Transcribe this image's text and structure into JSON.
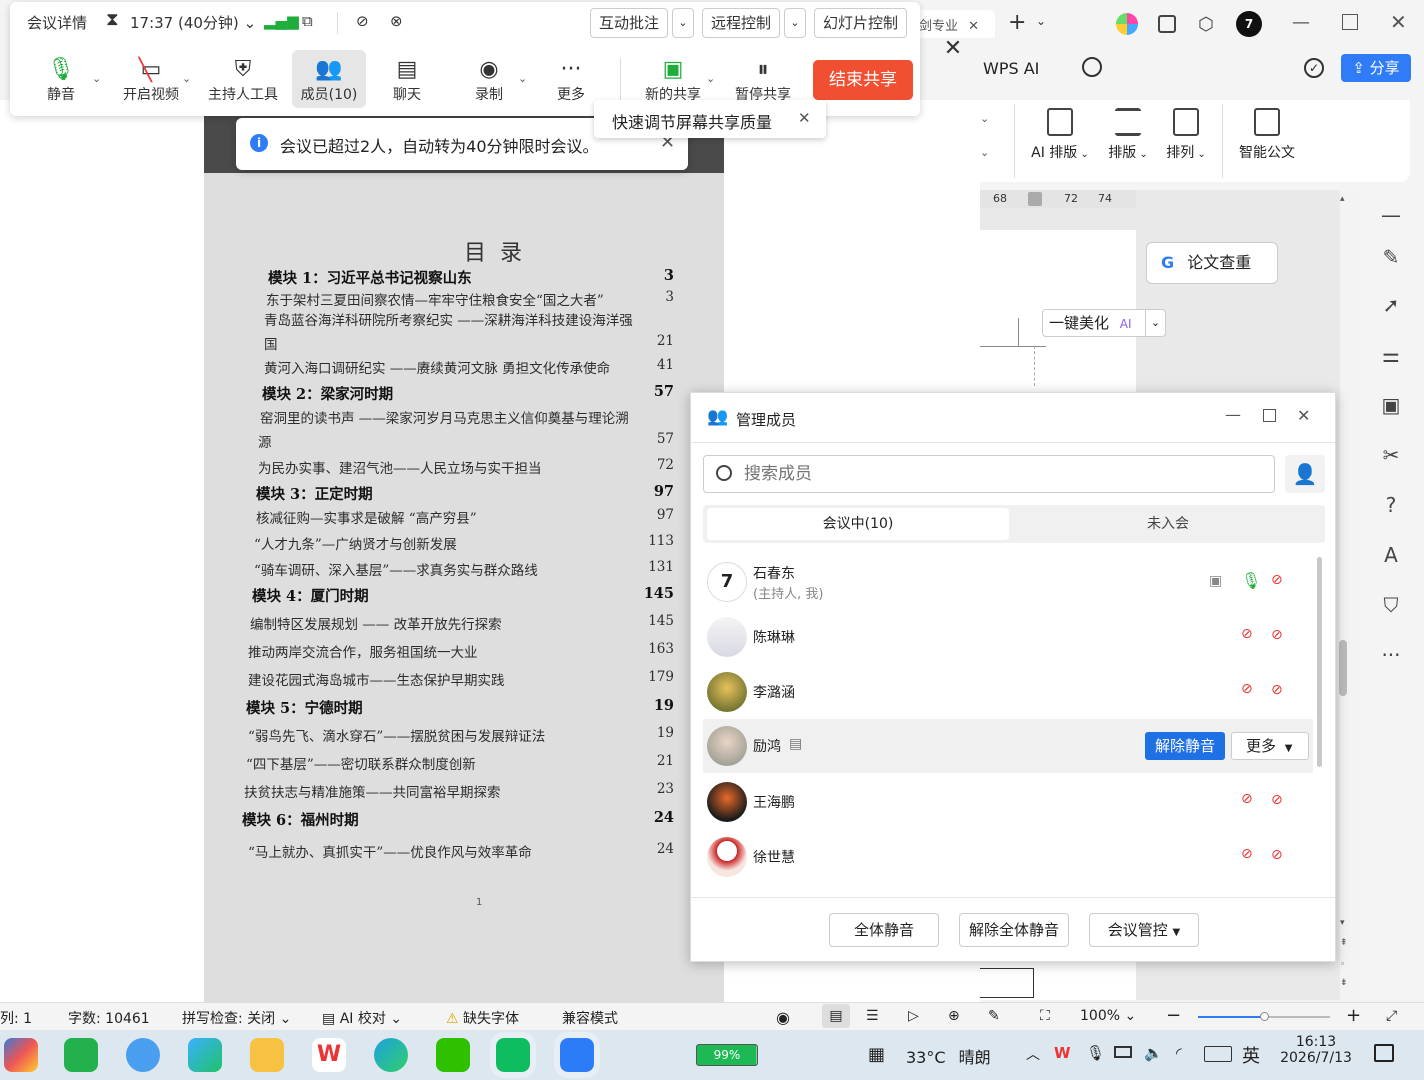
{
  "wps": {
    "tab_partial": "剑专业",
    "wps_ai": "WPS AI",
    "share": "分享",
    "tools": [
      "AI 排版",
      "排版",
      "排列",
      "智能公文"
    ],
    "ruler": [
      "68",
      "72",
      "74"
    ],
    "thesis_check": "论文查重",
    "beautify": "一键美化",
    "beautify_badge": "AI",
    "status": {
      "col": "列: 1",
      "word_count": "字数: 10461",
      "spell": "拼写检查: 关闭",
      "ai_proof": "AI 校对",
      "missing_font": "缺失字体",
      "compat": "兼容模式",
      "zoom": "100%"
    }
  },
  "meeting": {
    "details": "会议详情",
    "timer": "17:37 (40分钟)",
    "annotate": "互动批注",
    "remote": "远程控制",
    "slides": "幻灯片控制",
    "buttons": [
      {
        "label": "静音"
      },
      {
        "label": "开启视频"
      },
      {
        "label": "主持人工具"
      },
      {
        "label": "成员(10)"
      },
      {
        "label": "聊天"
      },
      {
        "label": "录制"
      },
      {
        "label": "更多"
      },
      {
        "label": "新的共享"
      },
      {
        "label": "暂停共享"
      }
    ],
    "end_share": "结束共享",
    "notice": "会议已超过2人，自动转为40分钟限时会议。",
    "tip": "快速调节屏幕共享质量"
  },
  "document": {
    "title": "目  录",
    "entries": [
      {
        "text": "模块 1：习近平总书记视察山东",
        "page": "3",
        "bold": true
      },
      {
        "text": "东于架村三夏田间察农情—牢牢守住粮食安全“国之大者”",
        "page": "3",
        "bold": false
      },
      {
        "text": "青岛蓝谷海洋科研院所考察纪实 ——深耕海洋科技建设海洋强",
        "page": "",
        "bold": false
      },
      {
        "text": "国",
        "page": "21",
        "bold": false
      },
      {
        "text": "黄河入海口调研纪实 ——赓续黄河文脉 勇担文化传承使命",
        "page": "41",
        "bold": false
      },
      {
        "text": "模块 2：梁家河时期",
        "page": "57",
        "bold": true
      },
      {
        "text": "窑洞里的读书声 ——梁家河岁月马克思主义信仰奠基与理论溯",
        "page": "",
        "bold": false
      },
      {
        "text": "源",
        "page": "57",
        "bold": false
      },
      {
        "text": "为民办实事、建沼气池——人民立场与实干担当",
        "page": "72",
        "bold": false
      },
      {
        "text": "模块 3：正定时期",
        "page": "97",
        "bold": true
      },
      {
        "text": "核减征购—实事求是破解 “高产穷县”",
        "page": "97",
        "bold": false
      },
      {
        "text": "“人才九条”—广纳贤才与创新发展",
        "page": "113",
        "bold": false
      },
      {
        "text": "“骑车调研、深入基层”——求真务实与群众路线",
        "page": "131",
        "bold": false
      },
      {
        "text": "模块 4：厦门时期",
        "page": "145",
        "bold": true
      },
      {
        "text": "编制特区发展规划 —— 改革开放先行探索",
        "page": "145",
        "bold": false
      },
      {
        "text": "推动两岸交流合作，服务祖国统一大业",
        "page": "163",
        "bold": false
      },
      {
        "text": "建设花园式海岛城市——生态保护早期实践",
        "page": "179",
        "bold": false
      },
      {
        "text": "模块 5：宁德时期",
        "page": "19",
        "bold": true
      },
      {
        "text": "“弱鸟先飞、滴水穿石”——摆脱贫困与发展辩证法",
        "page": "19",
        "bold": false
      },
      {
        "text": "“四下基层”——密切联系群众制度创新",
        "page": "21",
        "bold": false
      },
      {
        "text": "扶贫扶志与精准施策——共同富裕早期探索",
        "page": "23",
        "bold": false
      },
      {
        "text": "模块 6：福州时期",
        "page": "24",
        "bold": true
      },
      {
        "text": "“马上就办、真抓实干”——优良作风与效率革命",
        "page": "24",
        "bold": false
      }
    ],
    "page_num": "1"
  },
  "members_panel": {
    "title": "管理成员",
    "search_placeholder": "搜索成员",
    "tab_in": "会议中(10)",
    "tab_out": "未入会",
    "members": [
      {
        "name": "石春东",
        "sub": "(主持人, 我)"
      },
      {
        "name": "陈琳琳",
        "sub": ""
      },
      {
        "name": "李潞涵",
        "sub": ""
      },
      {
        "name": "励鸿",
        "sub": ""
      },
      {
        "name": "王海鹏",
        "sub": ""
      },
      {
        "name": "徐世慧",
        "sub": ""
      }
    ],
    "unmute": "解除静音",
    "more": "更多",
    "mute_all": "全体静音",
    "unmute_all": "解除全体静音",
    "control": "会议管控"
  },
  "taskbar": {
    "battery": "99%",
    "weather_temp": "33°C",
    "weather": "晴朗",
    "ime": "英",
    "time": "16:13",
    "date": "2026/7/13"
  }
}
